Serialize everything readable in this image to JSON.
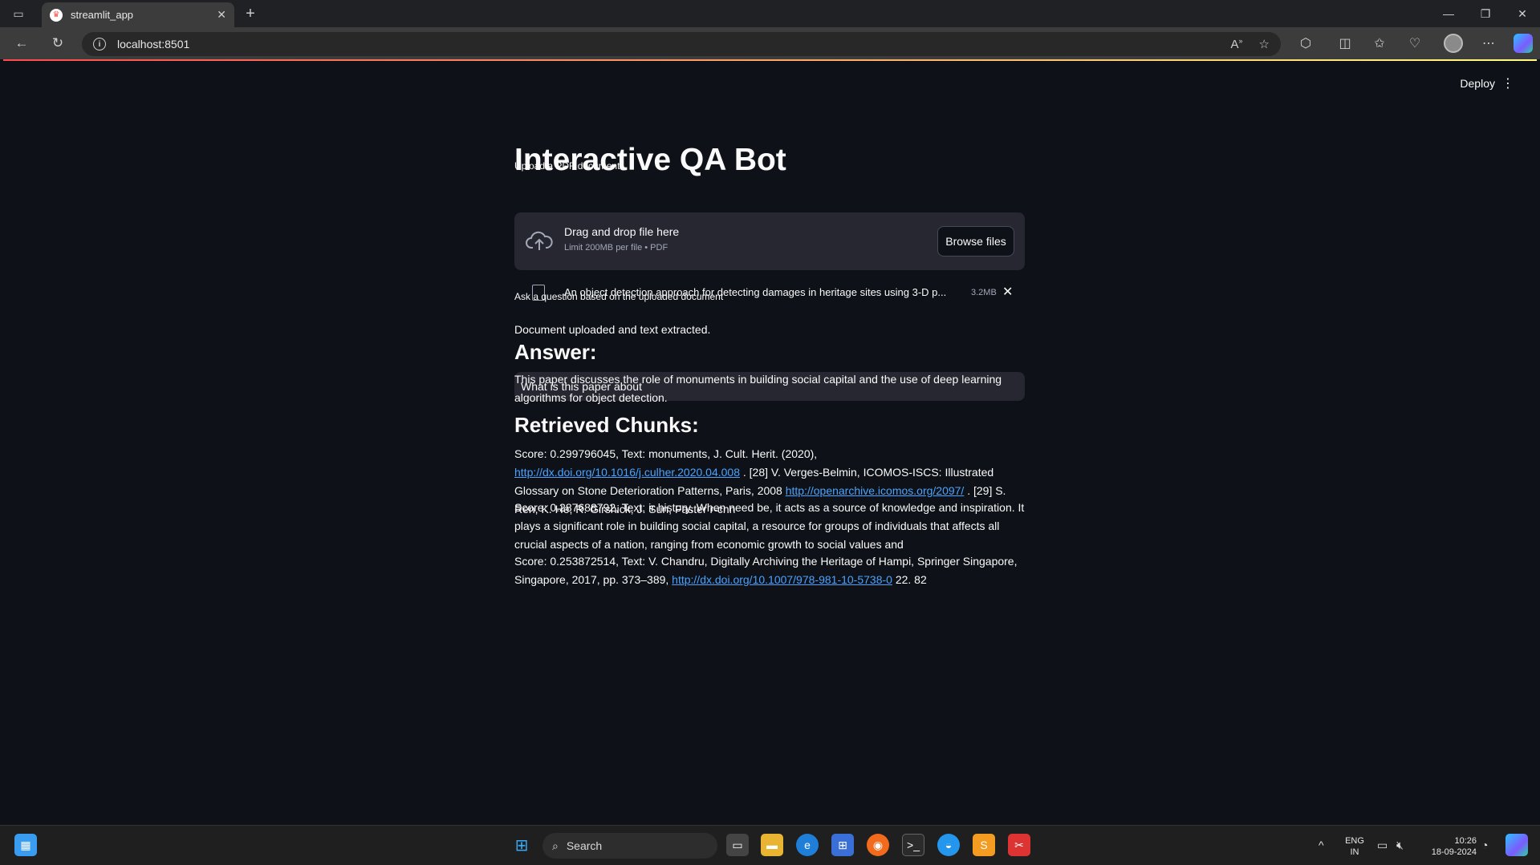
{
  "browser": {
    "tab_title": "streamlit_app",
    "url": "localhost:8501"
  },
  "app": {
    "deploy_label": "Deploy",
    "title": "Interactive QA Bot",
    "upload": {
      "label": "Upload a PDF document",
      "drop_title": "Drag and drop file here",
      "limit": "Limit 200MB per file • PDF",
      "browse_label": "Browse files"
    },
    "file": {
      "name": "An object detection approach for detecting damages in heritage sites using 3-D p...",
      "size": "3.2MB"
    },
    "status": "Document uploaded and text extracted.",
    "question": {
      "label": "Ask a question based on the uploaded document",
      "value": "What is this paper about"
    },
    "answer": {
      "heading": "Answer:",
      "text": "This paper discusses the role of monuments in building social capital and the use of deep learning algorithms for object detection."
    },
    "chunks": {
      "heading": "Retrieved Chunks:",
      "items": [
        {
          "part1": "Score: 0.299796045, Text: monuments, J. Cult. Herit. (2020), ",
          "link1": "http://dx.doi.org/10.1016/j.culher.2020.04.008",
          "part2": " . [28] V. Verges-Belmin, ICOMOS-ISCS: Illustrated Glossary on Stone Deterioration Patterns, Paris, 2008 ",
          "link2": "http://openarchive.icomos.org/2097/",
          "part3": " . [29] S. Ren, K. He, R. Girshick, J. Sun, Faster r-cnn"
        },
        {
          "text": "Score: 0.287688792, Text: ir history. When need be, it acts as a source of knowledge and inspiration. It plays a significant role in building social capital, a resource for groups of individuals that affects all crucial aspects of a nation, ranging from economic growth to social values and"
        },
        {
          "part1": "Score: 0.253872514, Text: V. Chandru, Digitally Archiving the Heritage of Hampi, Springer Singapore, Singapore, 2017, pp. 373–389, ",
          "link1": "http://dx.doi.org/10.1007/978-981-10-5738-0",
          "part2": " 22. 82"
        }
      ]
    }
  },
  "taskbar": {
    "search_label": "Search",
    "lang_primary": "ENG",
    "lang_secondary": "IN",
    "time": "10:26",
    "date": "18-09-2024"
  },
  "colors": {
    "background": "#0e1117",
    "widget_bg": "#262730",
    "link": "#4aa3ff",
    "accent_red": "#ff4b4b"
  }
}
